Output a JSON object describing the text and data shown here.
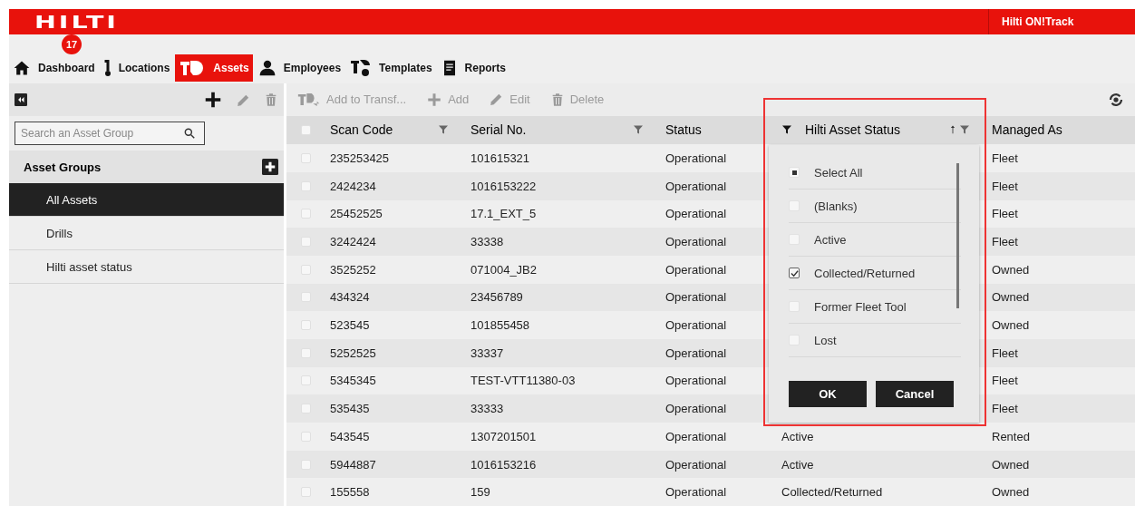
{
  "header": {
    "logo": "HILTI",
    "product": "Hilti ON!Track"
  },
  "nav": [
    {
      "label": "Dashboard",
      "kind": "home",
      "badge": "17",
      "selected": false
    },
    {
      "label": "Locations",
      "kind": "pin",
      "selected": false
    },
    {
      "label": "Assets",
      "kind": "tool",
      "selected": true
    },
    {
      "label": "Employees",
      "kind": "person",
      "selected": false
    },
    {
      "label": "Templates",
      "kind": "template",
      "selected": false
    },
    {
      "label": "Reports",
      "kind": "report",
      "selected": false
    }
  ],
  "sidebar": {
    "search": {
      "placeholder": "Search an Asset Group"
    },
    "heading": "Asset Groups",
    "items": [
      {
        "label": "All Assets",
        "selected": true
      },
      {
        "label": "Drills",
        "selected": false
      },
      {
        "label": "Hilti asset status",
        "selected": false
      }
    ]
  },
  "toolbar": [
    {
      "label": "Add to Transf...",
      "kind": "transfer"
    },
    {
      "label": "Add",
      "kind": "plus"
    },
    {
      "label": "Edit",
      "kind": "pencil"
    },
    {
      "label": "Delete",
      "kind": "trash"
    }
  ],
  "table": {
    "all_checked": false,
    "columns": [
      {
        "label": "Scan Code",
        "filterable": true
      },
      {
        "label": "Serial No.",
        "filterable": true
      },
      {
        "label": "Status",
        "filterable": false
      },
      {
        "label": "Hilti Asset Status",
        "filterable": true,
        "filtered": true,
        "sorted": true
      },
      {
        "label": "Managed As",
        "filterable": false
      }
    ],
    "rows": [
      {
        "checked": false,
        "scan": "235253425",
        "serial": "101615321",
        "status": "Operational",
        "managed": "Fleet"
      },
      {
        "checked": false,
        "scan": "2424234",
        "serial": "1016153222",
        "status": "Operational",
        "managed": "Fleet"
      },
      {
        "checked": false,
        "scan": "25452525",
        "serial": "17.1_EXT_5",
        "status": "Operational",
        "managed": "Fleet"
      },
      {
        "checked": false,
        "scan": "3242424",
        "serial": "33338",
        "status": "Operational",
        "managed": "Fleet"
      },
      {
        "checked": false,
        "scan": "3525252",
        "serial": "071004_JB2",
        "status": "Operational",
        "managed": "Owned"
      },
      {
        "checked": false,
        "scan": "434324",
        "serial": "23456789",
        "status": "Operational",
        "managed": "Owned"
      },
      {
        "checked": false,
        "scan": "523545",
        "serial": "101855458",
        "status": "Operational",
        "managed": "Owned"
      },
      {
        "checked": false,
        "scan": "5252525",
        "serial": "33337",
        "status": "Operational",
        "managed": "Fleet"
      },
      {
        "checked": false,
        "scan": "5345345",
        "serial": "TEST-VTT11380-03",
        "status": "Operational",
        "managed": "Fleet"
      },
      {
        "checked": false,
        "scan": "535435",
        "serial": "33333",
        "status": "Operational",
        "managed": "Fleet"
      },
      {
        "checked": false,
        "scan": "543545",
        "serial": "1307201501",
        "status": "Operational",
        "hilti": "Active",
        "managed": "Rented"
      },
      {
        "checked": false,
        "scan": "5944887",
        "serial": "1016153216",
        "status": "Operational",
        "hilti": "Active",
        "managed": "Owned"
      },
      {
        "checked": false,
        "scan": "155558",
        "serial": "159",
        "status": "Operational",
        "hilti": "Collected/Returned",
        "managed": "Owned"
      }
    ]
  },
  "filter_popup": {
    "select_all": {
      "label": "Select All",
      "indeterminate": true
    },
    "options": [
      {
        "label": "(Blanks)",
        "checked": false
      },
      {
        "label": "Active",
        "checked": false
      },
      {
        "label": "Collected/Returned",
        "checked": true
      },
      {
        "label": "Former Fleet Tool",
        "checked": false
      },
      {
        "label": "Lost",
        "checked": false
      }
    ],
    "buttons": [
      "OK",
      "Cancel"
    ]
  }
}
